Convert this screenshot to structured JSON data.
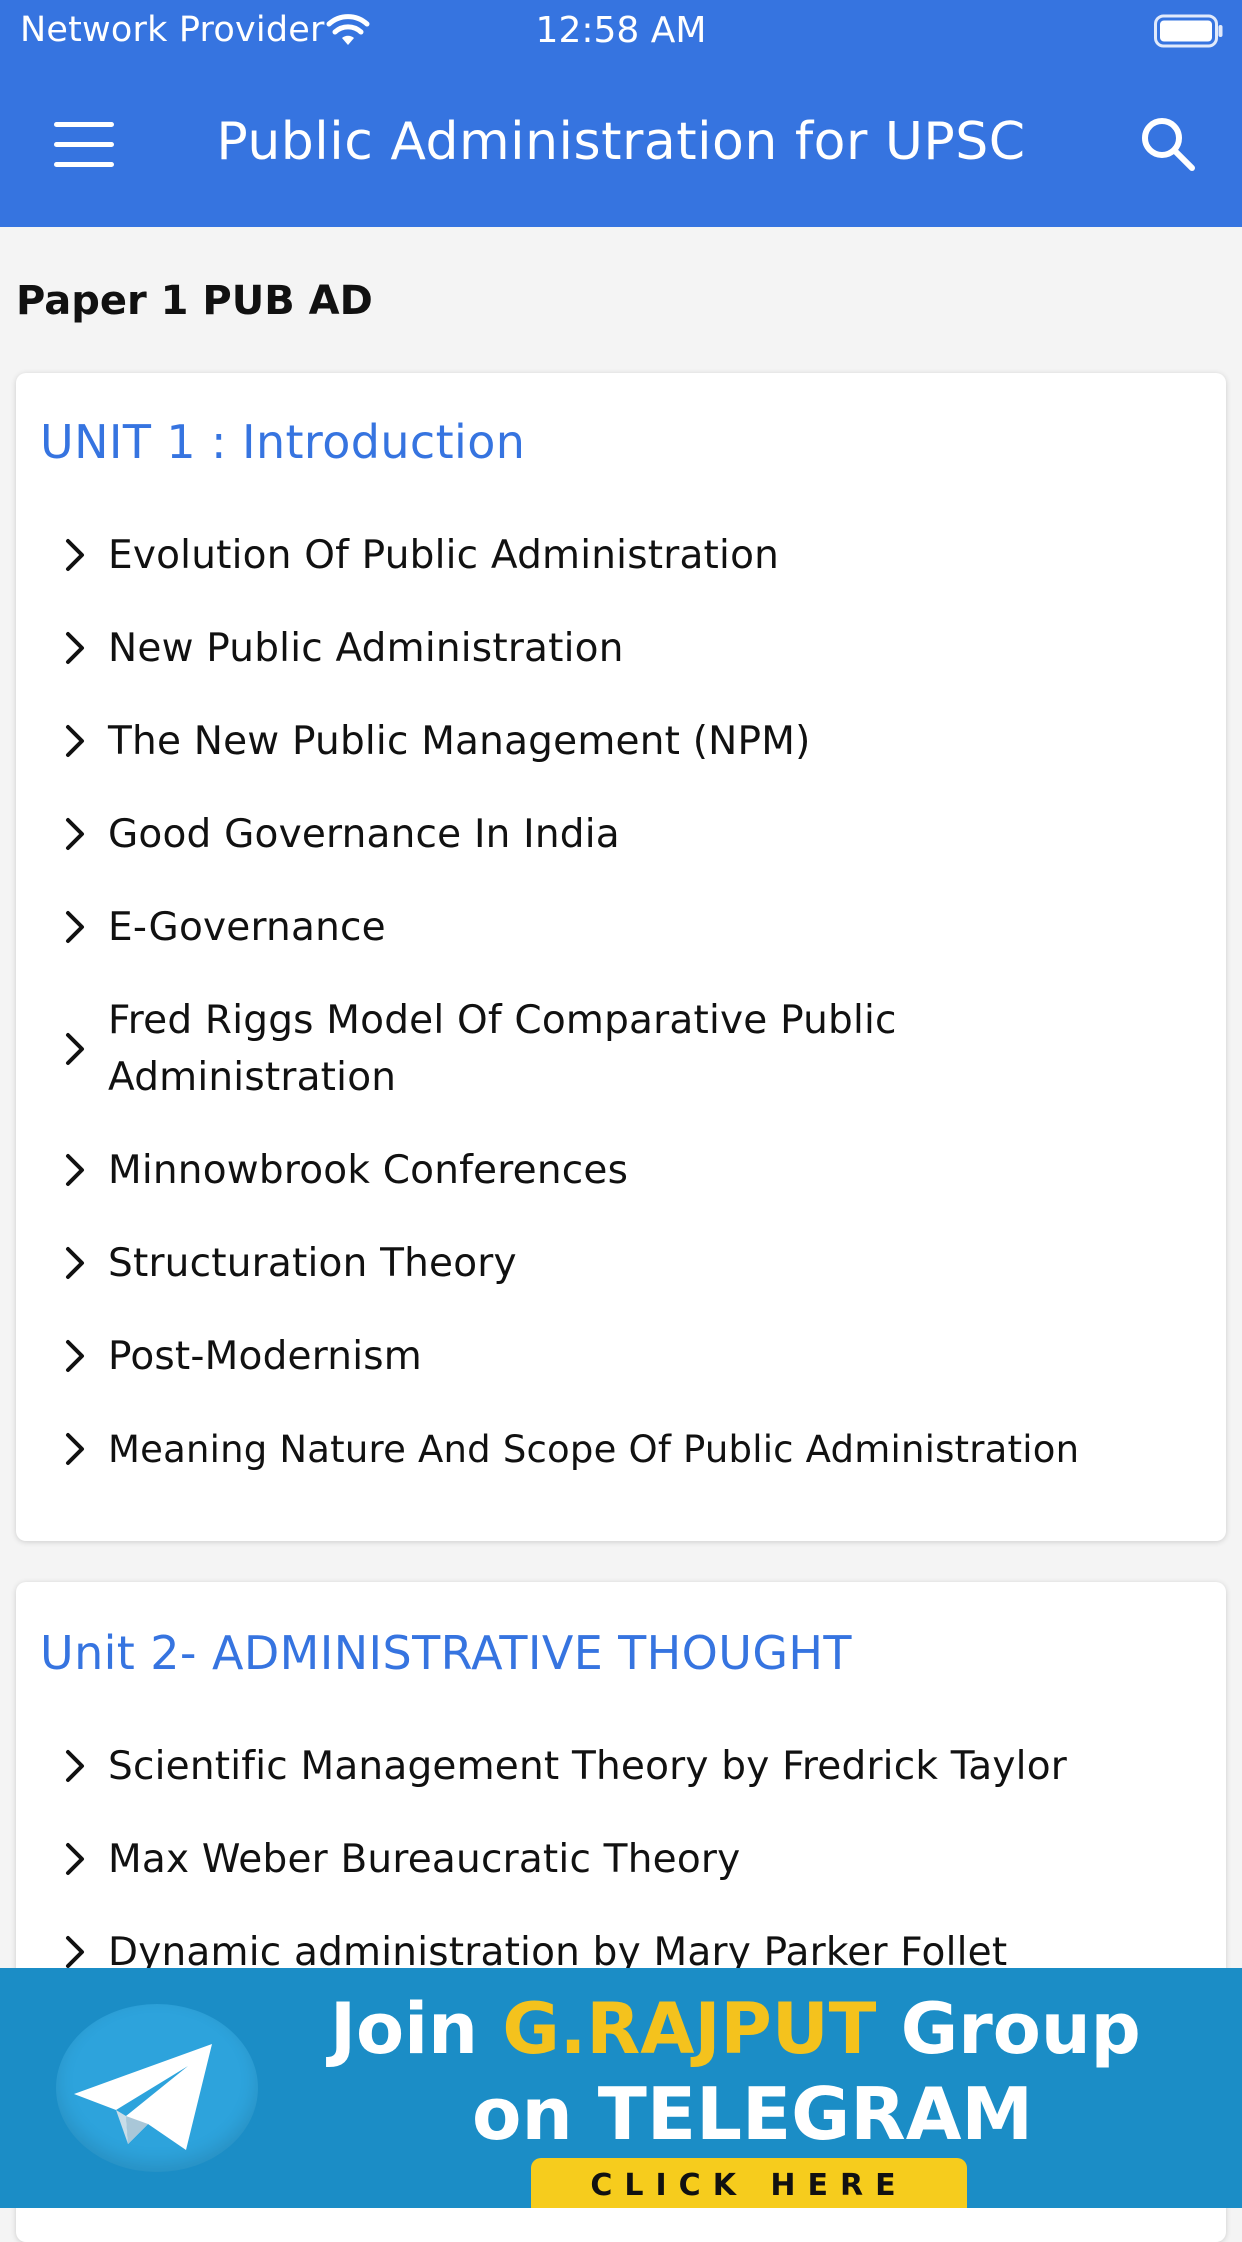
{
  "status_bar": {
    "carrier": "Network Provider",
    "time": "12:58 AM"
  },
  "app_bar": {
    "title": "Public Administration for UPSC",
    "menu_icon": "hamburger-menu-icon",
    "search_icon": "search-icon",
    "background_color": "#3674e0"
  },
  "section": {
    "heading": "Paper 1 PUB AD"
  },
  "units": [
    {
      "title": "UNIT 1 : Introduction",
      "items": [
        "Evolution Of Public Administration",
        "New Public Administration",
        "The New Public Management (NPM)",
        "Good Governance In India",
        "E-Governance",
        "Fred Riggs Model Of Comparative Public Administration",
        "Minnowbrook Conferences",
        "Structuration Theory",
        "Post-Modernism",
        "Meaning Nature And Scope Of Public Administration"
      ]
    },
    {
      "title": "Unit 2- ADMINISTRATIVE THOUGHT",
      "items": [
        "Scientific Management Theory by Fredrick Taylor",
        "Max Weber Bureaucratic Theory",
        "Dynamic administration by Mary Parker Follet"
      ]
    }
  ],
  "banner": {
    "line1_prefix": "Join ",
    "line1_accent": "G.RAJPUT",
    "line1_suffix": " Group",
    "line2": "on TELEGRAM",
    "cta": "CLICK HERE",
    "icon": "telegram-icon",
    "accent_color": "#f4c21d"
  }
}
